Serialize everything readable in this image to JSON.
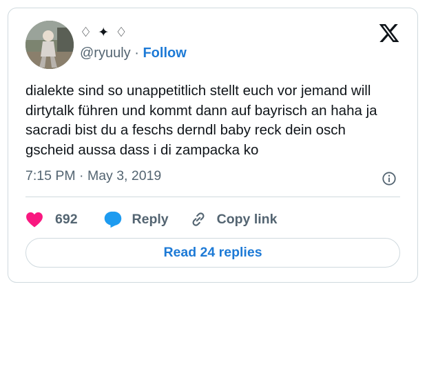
{
  "tweet": {
    "display_name": "♢ ✦ ♢",
    "handle": "@ryuuly",
    "separator": "·",
    "follow_label": "Follow",
    "text": "dialekte sind so unappetitlich stellt euch vor jemand will dirtytalk führen und kommt dann auf bayrisch an haha ja sacradi bist du a feschs derndl baby reck dein osch gscheid aussa dass i di zampacka ko",
    "timestamp": "7:15 PM · May 3, 2019"
  },
  "actions": {
    "like_count": "692",
    "reply_label": "Reply",
    "copy_link_label": "Copy link"
  },
  "footer": {
    "read_replies_label": "Read 24 replies"
  },
  "colors": {
    "accent": "#1d7ad6",
    "like": "#f91880",
    "reply_icon": "#1d9bf0",
    "muted": "#536471",
    "border": "#cfd9de"
  },
  "icons": [
    "x-logo-icon",
    "info-icon",
    "heart-icon",
    "reply-bubble-icon",
    "link-icon"
  ]
}
